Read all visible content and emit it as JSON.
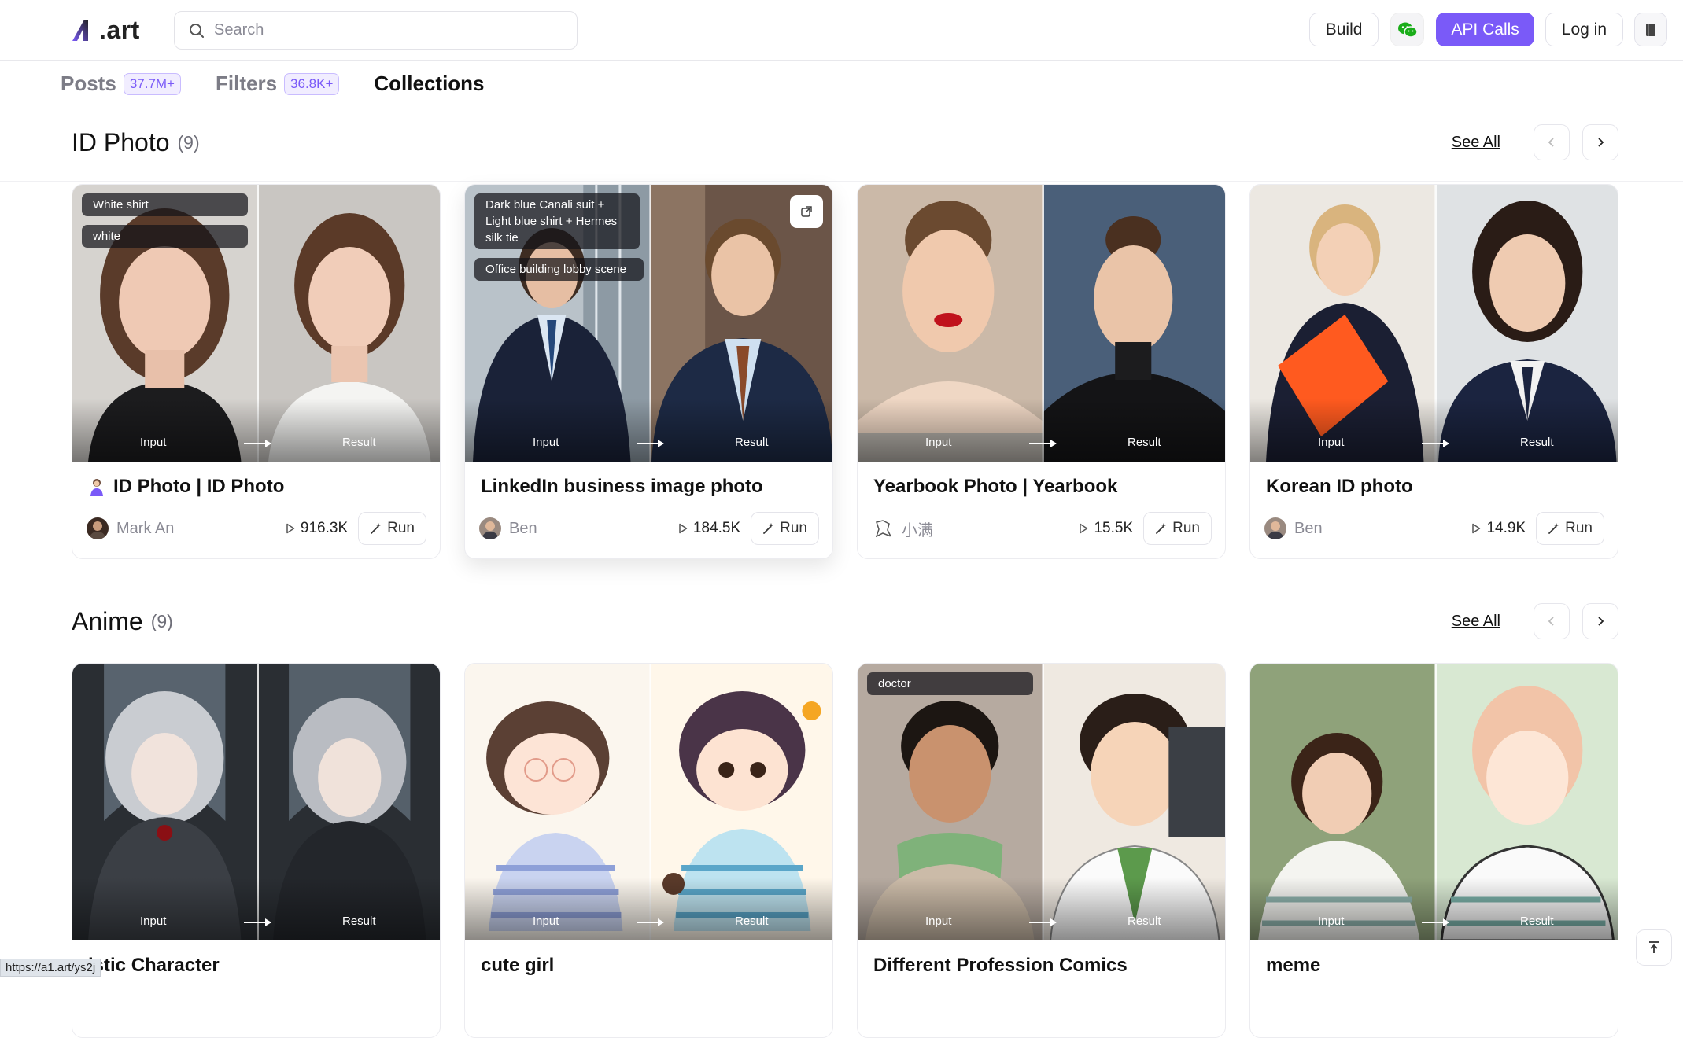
{
  "header": {
    "logo_text": ".art",
    "search_placeholder": "Search",
    "build_label": "Build",
    "api_calls_label": "API Calls",
    "login_label": "Log in",
    "accent_color": "#7a5af8",
    "wechat_color": "#1aad19"
  },
  "tabs": [
    {
      "label": "Posts",
      "badge": "37.7M+"
    },
    {
      "label": "Filters",
      "badge": "36.8K+"
    },
    {
      "label": "Collections",
      "badge": ""
    }
  ],
  "sections": [
    {
      "title": "ID Photo",
      "count": "(9)",
      "see_all": "See All",
      "cards": [
        {
          "title": "ID Photo | ID Photo",
          "title_icon": "person-emoji-icon",
          "author": "Mark An",
          "runs": "916.3K",
          "run_label": "Run",
          "tags": [
            "White shirt",
            "white"
          ],
          "input_label": "Input",
          "result_label": "Result"
        },
        {
          "title": "LinkedIn business image photo",
          "author": "Ben",
          "runs": "184.5K",
          "run_label": "Run",
          "tags": [
            "Dark blue Canali suit + Light blue shirt + Hermes silk tie",
            "Office building lobby scene"
          ],
          "input_label": "Input",
          "result_label": "Result"
        },
        {
          "title": "Yearbook Photo | Yearbook",
          "author": "小满",
          "runs": "15.5K",
          "run_label": "Run",
          "tags": [],
          "input_label": "Input",
          "result_label": "Result"
        },
        {
          "title": "Korean ID photo",
          "author": "Ben",
          "runs": "14.9K",
          "run_label": "Run",
          "tags": [],
          "input_label": "Input",
          "result_label": "Result"
        }
      ]
    },
    {
      "title": "Anime",
      "count": "(9)",
      "see_all": "See All",
      "cards": [
        {
          "title": "istic Character",
          "input_label": "Input",
          "result_label": "Result",
          "tags": []
        },
        {
          "title": "cute girl",
          "input_label": "Input",
          "result_label": "Result",
          "tags": []
        },
        {
          "title": "Different Profession Comics",
          "input_label": "Input",
          "result_label": "Result",
          "tags": [
            "doctor"
          ]
        },
        {
          "title": "meme",
          "input_label": "Input",
          "result_label": "Result",
          "tags": []
        }
      ]
    }
  ],
  "status_url": "https://a1.art/ys2j"
}
